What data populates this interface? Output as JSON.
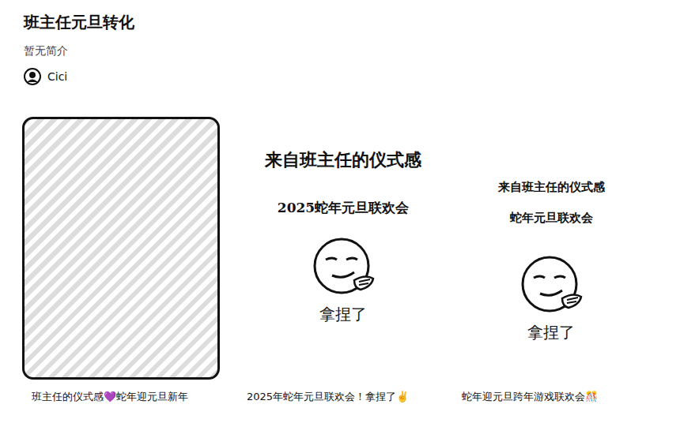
{
  "collection": {
    "title": "班主任元旦转化",
    "description": "暂无简介",
    "author": "Cici"
  },
  "notes": [
    {
      "kind": "photo",
      "caption": "班主任的仪式感💜蛇年迎元旦新年"
    },
    {
      "kind": "text-cover",
      "cover_lines": [
        "来自班主任的仪式感",
        "2025蛇年元旦联欢会"
      ],
      "cover_label": "拿捏了",
      "caption": "2025年蛇年元旦联欢会！拿捏了✌️"
    },
    {
      "kind": "text-cover",
      "cover_lines": [
        "来自班主任的仪式感",
        "蛇年元旦联欢会"
      ],
      "cover_label": "拿捏了",
      "caption": "蛇年迎元旦跨年游戏联欢会🎊"
    }
  ]
}
